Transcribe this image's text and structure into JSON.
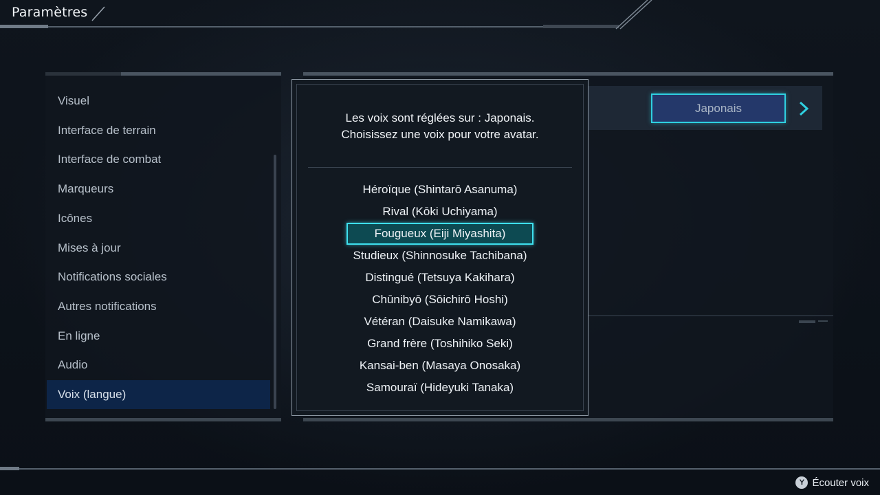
{
  "header": {
    "title": "Paramètres"
  },
  "sidebar": {
    "items": [
      {
        "label": "Visuel"
      },
      {
        "label": "Interface de terrain"
      },
      {
        "label": "Interface de combat"
      },
      {
        "label": "Marqueurs"
      },
      {
        "label": "Icônes"
      },
      {
        "label": "Mises à jour"
      },
      {
        "label": "Notifications sociales"
      },
      {
        "label": "Autres notifications"
      },
      {
        "label": "En ligne"
      },
      {
        "label": "Audio"
      },
      {
        "label": "Voix (langue)"
      }
    ],
    "selected_index": 10
  },
  "settings": {
    "language_value": "Japonais"
  },
  "dialog": {
    "message_line1": "Les voix sont réglées sur : Japonais.",
    "message_line2": "Choisissez une voix pour votre avatar.",
    "voices": [
      {
        "label": "Héroïque (Shintarō Asanuma)"
      },
      {
        "label": "Rival (Kōki Uchiyama)"
      },
      {
        "label": "Fougueux (Eiji Miyashita)"
      },
      {
        "label": "Studieux (Shinnosuke Tachibana)"
      },
      {
        "label": "Distingué (Tetsuya Kakihara)"
      },
      {
        "label": "Chūnibyō (Sōichirō Hoshi)"
      },
      {
        "label": "Vétéran (Daisuke Namikawa)"
      },
      {
        "label": "Grand frère (Toshihiko Seki)"
      },
      {
        "label": "Kansai-ben (Masaya Onosaka)"
      },
      {
        "label": "Samouraï (Hideyuki Tanaka)"
      }
    ],
    "selected_index": 2
  },
  "footer": {
    "button_glyph": "Y",
    "hint_label": "Écouter voix"
  },
  "colors": {
    "accent_cyan": "#3ee0ee",
    "selected_menu_bg": "#0d2548",
    "selected_voice_bg": "#0d4a52"
  }
}
